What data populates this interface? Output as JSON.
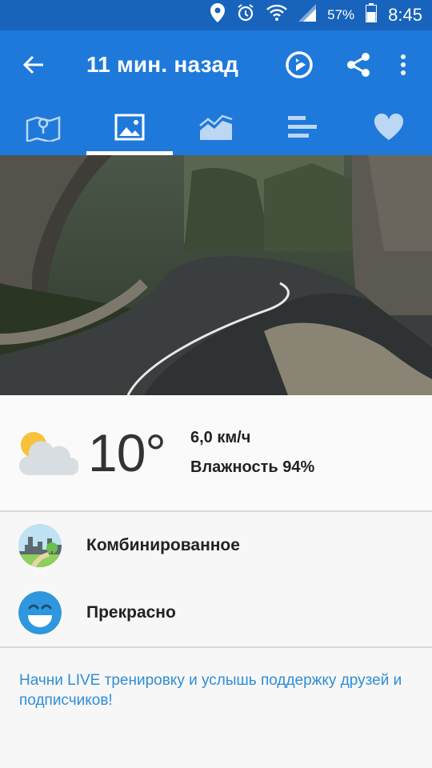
{
  "status_bar": {
    "battery_percent": "57%",
    "time": "8:45",
    "icons": [
      "location-icon",
      "alarm-icon",
      "wifi-icon",
      "signal-icon",
      "battery-icon"
    ]
  },
  "app_bar": {
    "title": "11 мин. назад",
    "actions": [
      "back-arrow-icon",
      "replay-route-icon",
      "share-icon",
      "more-vert-icon"
    ]
  },
  "tabs": [
    {
      "icon": "map-icon",
      "active": false
    },
    {
      "icon": "image-icon",
      "active": true
    },
    {
      "icon": "area-chart-icon",
      "active": false
    },
    {
      "icon": "bar-list-icon",
      "active": false
    },
    {
      "icon": "heart-icon",
      "active": false
    }
  ],
  "weather": {
    "icon": "partly-cloudy-icon",
    "temperature": "10°",
    "wind": "6,0 км/ч",
    "humidity": "Влажность 94%"
  },
  "surface": {
    "icon": "mixed-terrain-icon",
    "label": "Комбинированное"
  },
  "feeling": {
    "icon": "smile-icon",
    "label": "Прекрасно"
  },
  "promo_text": "Начни LIVE тренировку и услышь поддержку друзей и подписчиков!",
  "colors": {
    "primary": "#1e79db",
    "status_bar": "#1863bb",
    "link": "#2f8ed8",
    "background": "#fafafa"
  }
}
